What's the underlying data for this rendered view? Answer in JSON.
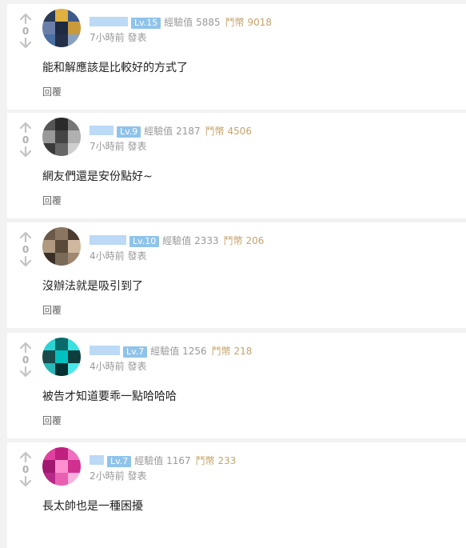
{
  "vote_score": "0",
  "reply_label": "回覆",
  "comments": [
    {
      "level": "Lv.15",
      "exp": "經驗值 5885",
      "coins": "鬥幣 9018",
      "time": "7小時前 發表",
      "content": "能和解應該是比較好的方式了",
      "avatar_colors": [
        "#2b3a55",
        "#e0b040",
        "#3d5a8a",
        "#6a7fa8",
        "#1e2a40",
        "#c89a3a",
        "#4a6fa0",
        "#233048",
        "#8aa0c0"
      ]
    },
    {
      "level": "Lv.9",
      "exp": "經驗值 2187",
      "coins": "鬥幣 4506",
      "time": "7小時前 發表",
      "content": "網友們還是安份點好~",
      "avatar_colors": [
        "#555555",
        "#2a2a2a",
        "#777777",
        "#999999",
        "#444444",
        "#b0b0b0",
        "#3a3a3a",
        "#666666",
        "#cfcfcf"
      ]
    },
    {
      "level": "Lv.10",
      "exp": "經驗值 2333",
      "coins": "鬥幣 206",
      "time": "4小時前 發表",
      "content": "沒辦法就是吸引到了",
      "avatar_colors": [
        "#6b5a4a",
        "#8a7560",
        "#4a3c30",
        "#b09a80",
        "#5a4a3a",
        "#d0b8a0",
        "#3a3028",
        "#7a6a58",
        "#a08870"
      ]
    },
    {
      "level": "Lv.7",
      "exp": "經驗值 1256",
      "coins": "鬥幣 218",
      "time": "4小時前 發表",
      "content": "被告才知道要乖一點哈哈哈",
      "avatar_colors": [
        "#2ad4d4",
        "#0a6a6a",
        "#3ae0e0",
        "#1a4a4a",
        "#00c0c0",
        "#0d3d3d",
        "#28b8b8",
        "#063030",
        "#4ae8e8"
      ]
    },
    {
      "level": "Lv.7",
      "exp": "經驗值 1167",
      "coins": "鬥幣 233",
      "time": "2小時前 發表",
      "content": "長太帥也是一種困擾",
      "avatar_colors": [
        "#e040a0",
        "#c02080",
        "#f070c0",
        "#a01870",
        "#ff90d0",
        "#d03090",
        "#b82888",
        "#e860b0",
        "#f8b0dc"
      ]
    }
  ]
}
